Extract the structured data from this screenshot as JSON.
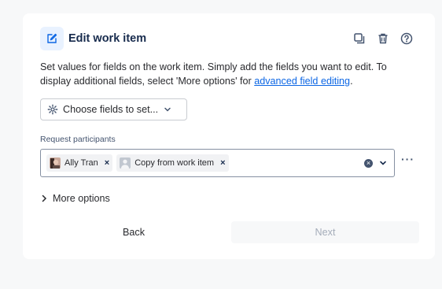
{
  "header": {
    "title": "Edit work item",
    "icons": [
      "edit-icon",
      "duplicate-icon",
      "trash-icon",
      "help-icon"
    ]
  },
  "description": {
    "text": "Set values for fields on the work item. Simply add the fields you want to edit. To display additional fields, select 'More options' for",
    "link": "advanced field editing",
    "end": "."
  },
  "choose_fields": {
    "label": "Choose fields to set..."
  },
  "request_participants": {
    "label": "Request participants",
    "chips": [
      {
        "label": "Ally Tran"
      },
      {
        "label": "Copy from work item"
      }
    ]
  },
  "more_options": {
    "label": "More options"
  },
  "footer": {
    "back_label": "Back",
    "next_label": "Next"
  },
  "colors": {
    "accent": "#0c66e4",
    "icon_bg": "#e9f2ff"
  }
}
